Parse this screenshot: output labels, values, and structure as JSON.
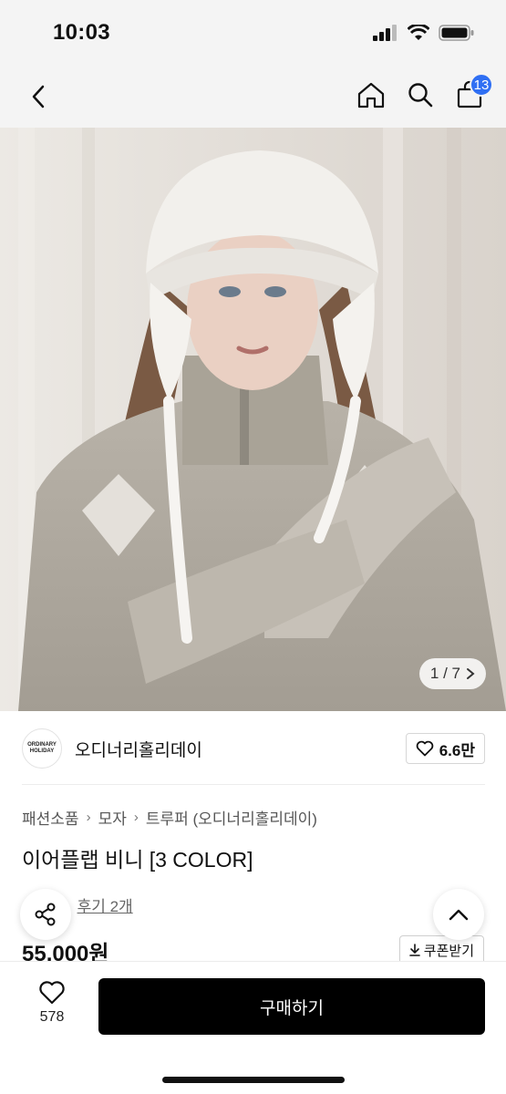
{
  "status_bar": {
    "time": "10:03"
  },
  "nav": {
    "cart_count": "13"
  },
  "gallery": {
    "counter": "1 / 7"
  },
  "brand": {
    "logo_line1": "ORDINARY",
    "logo_line2": "HOLIDAY",
    "name": "오디너리홀리데이",
    "likes": "6.6만"
  },
  "breadcrumb": [
    "패션소품",
    "모자",
    "트루퍼 (오디너리홀리데이)"
  ],
  "product": {
    "title": "이어플랩 비니 [3 COLOR]",
    "review_text": "후기 2개",
    "price": "55,000원",
    "coupon_label": "쿠폰받기"
  },
  "bottom_bar": {
    "wish_count": "578",
    "buy_label": "구매하기"
  },
  "colors": {
    "accent": "#2f6ff3",
    "buy_button": "#000000"
  }
}
